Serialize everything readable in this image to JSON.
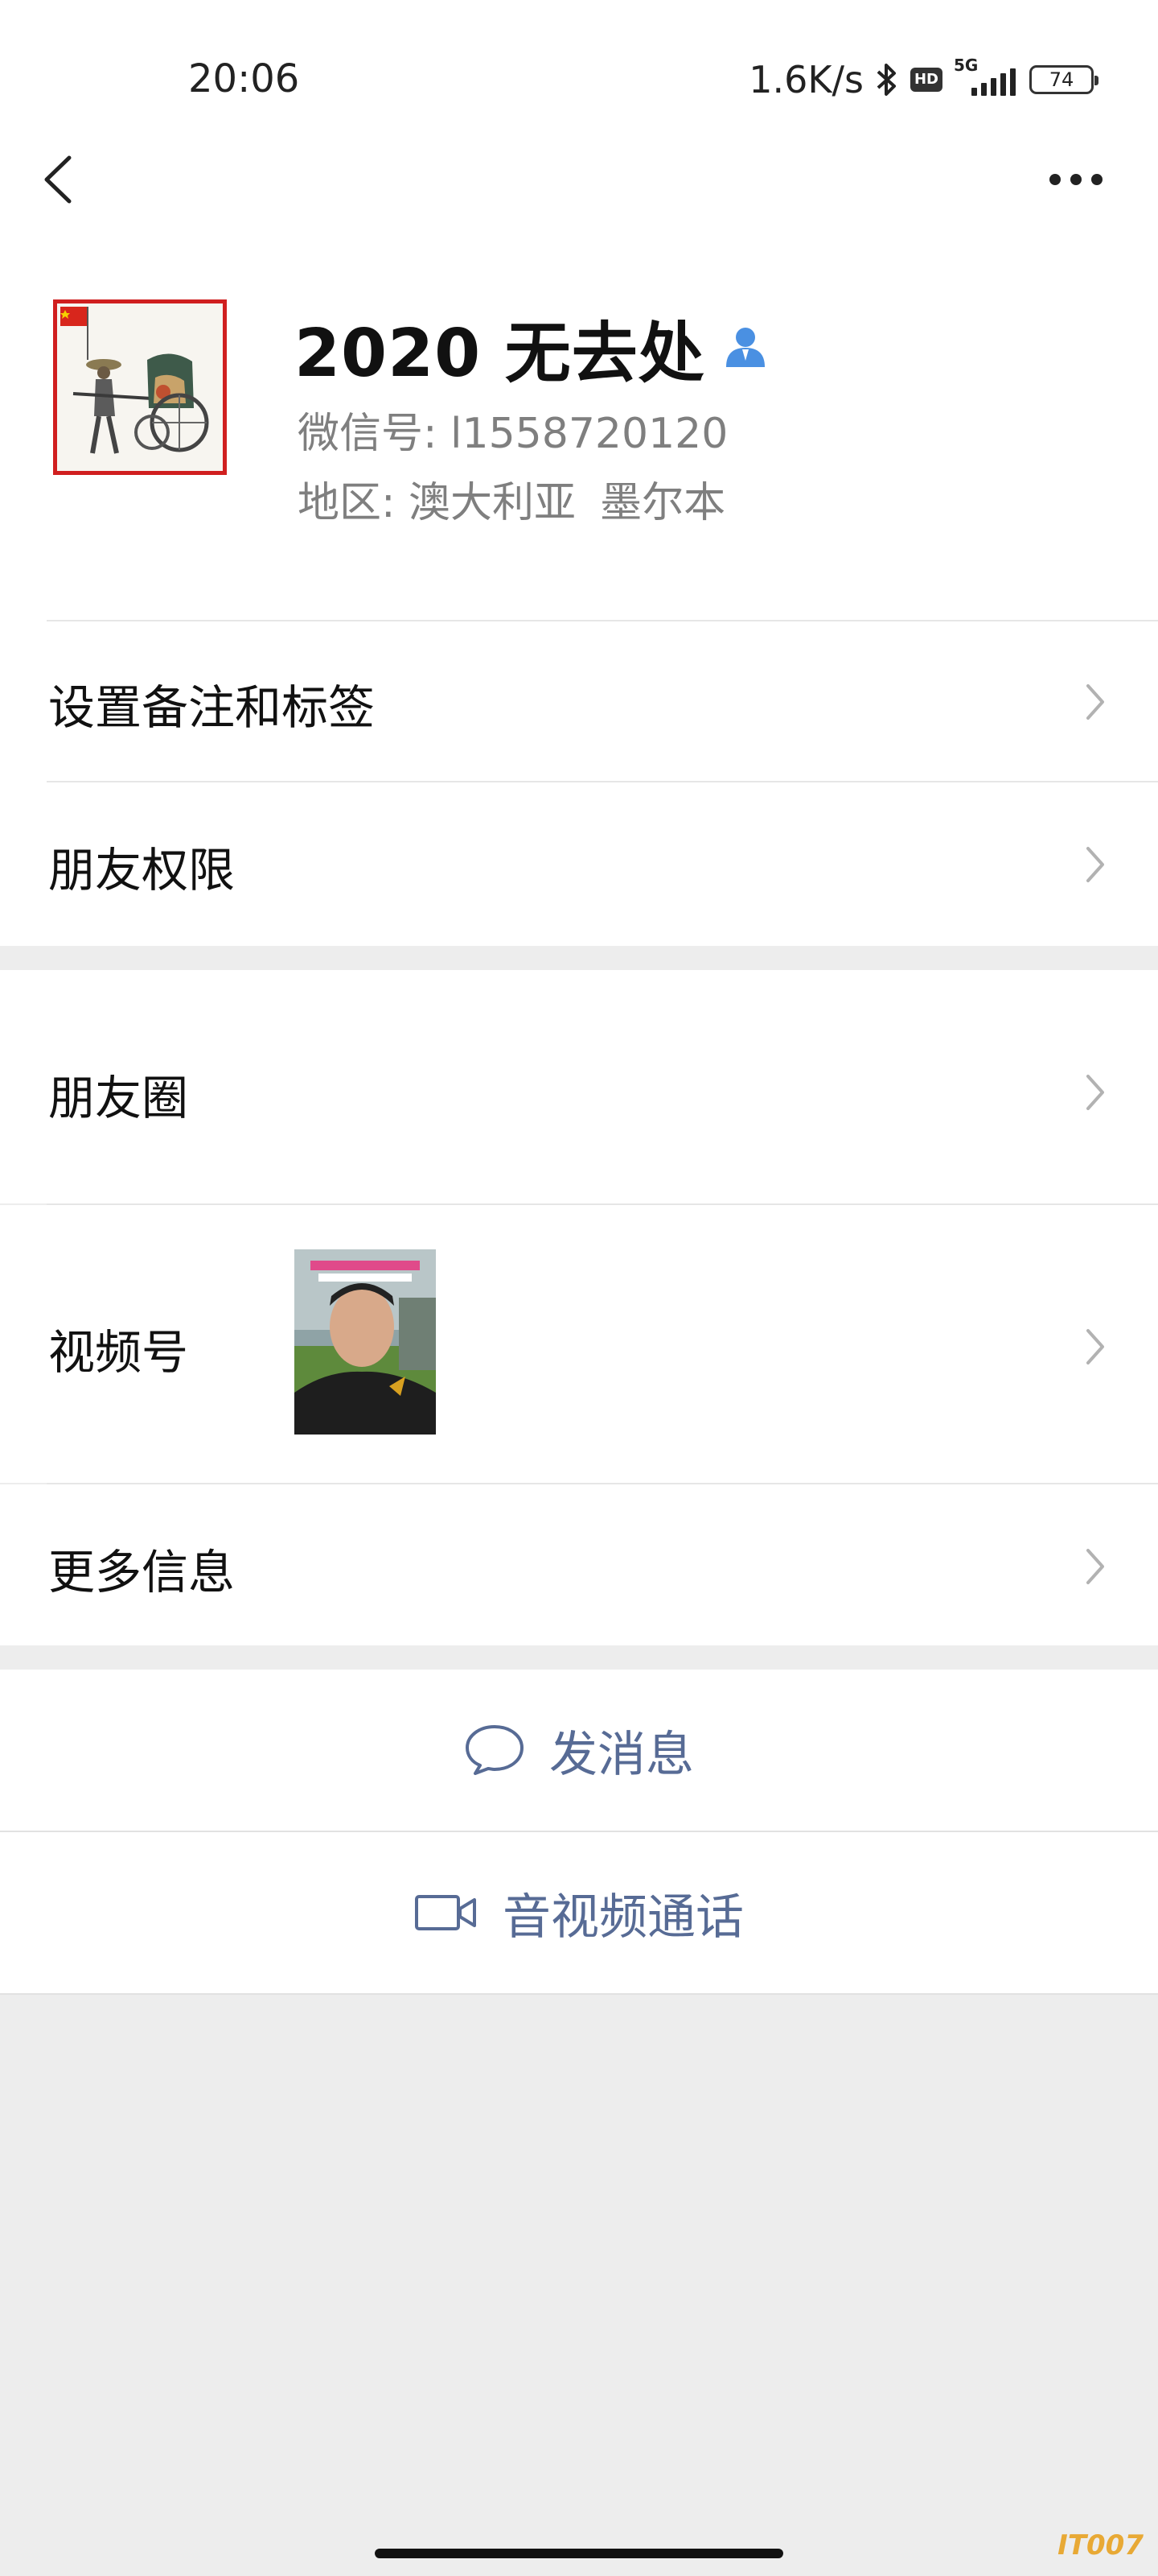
{
  "status_bar": {
    "time": "20:06",
    "net_speed": "1.6K/s",
    "hd": "HD",
    "network": "5G",
    "battery": "74"
  },
  "nav": {
    "back_icon": "chevron-left-icon",
    "more_icon": "more-dots-icon"
  },
  "profile": {
    "name": "2020 无去处",
    "wechat_id": "微信号:  l1558720120",
    "region_label": "地区:  澳大利亚",
    "region_city": "墨尔本",
    "badge_icon": "person-icon"
  },
  "rows": {
    "remark": "设置备注和标签",
    "permissions": "朋友权限",
    "moments": "朋友圈",
    "channels": "视频号",
    "more_info": "更多信息"
  },
  "actions": {
    "message": "发消息",
    "call": "音视频通话"
  },
  "watermark": "IT007",
  "colors": {
    "link_blue": "#576b95",
    "background_gray": "#ededed",
    "avatar_border": "#d01f1f",
    "badge_blue": "#4a90e2"
  }
}
